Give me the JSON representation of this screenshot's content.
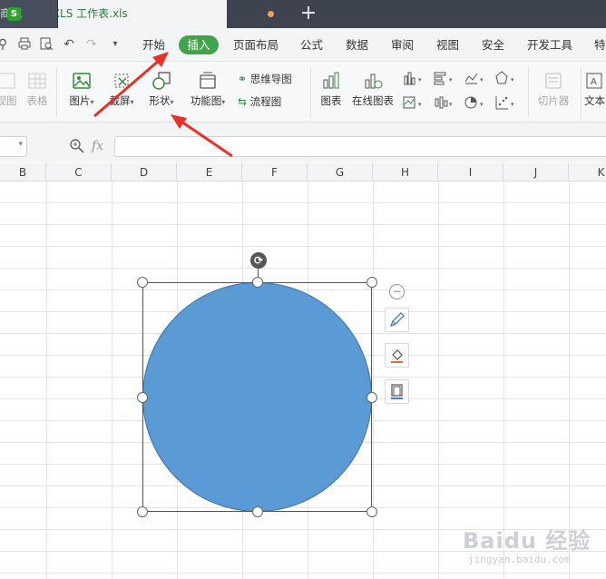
{
  "tabs": {
    "store_label": "稻壳商城",
    "file_label": "新建 XLS 工作表.xls",
    "file_icon_letter": "S",
    "new_tab_symbol": "+"
  },
  "menu": {
    "items": [
      "开始",
      "插入",
      "页面布局",
      "公式",
      "数据",
      "审阅",
      "视图",
      "安全",
      "开发工具",
      "特"
    ],
    "active": "插入"
  },
  "ribbon": {
    "left_partial": [
      "视图",
      "表格"
    ],
    "picture": "图片",
    "screenshot": "截屏",
    "shape": "形状",
    "function_chart": "功能图",
    "mindmap": "思维导图",
    "flowchart": "流程图",
    "chart": "图表",
    "online_chart": "在线图表",
    "slicer": "切片器",
    "textbox": "文本"
  },
  "formula_bar": {
    "fx_label": "fx",
    "value": ""
  },
  "columns": [
    "B",
    "C",
    "D",
    "E",
    "F",
    "G",
    "H",
    "I",
    "J",
    "K"
  ],
  "shape": {
    "type": "circle",
    "fill": "#5b9bd5",
    "outline": "#41719c"
  },
  "colors": {
    "tab_bar": "#3d4450",
    "accent_green": "#3fa44a",
    "arrow_red": "#e8302a"
  },
  "watermark": {
    "text": "Baidu 经验",
    "sub": "jingyan.baidu.com"
  }
}
